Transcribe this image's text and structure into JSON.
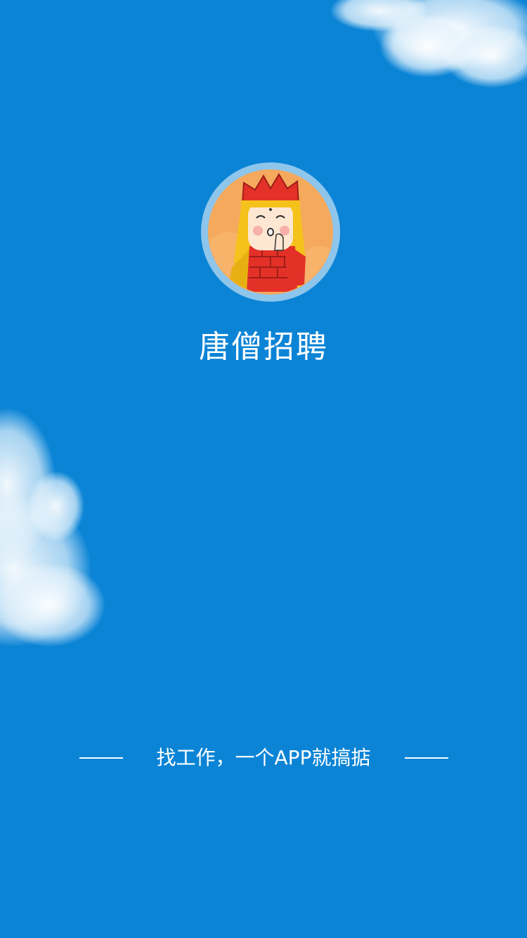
{
  "splash": {
    "app_name": "唐僧招聘",
    "slogan": "找工作，一个APP就搞掂"
  },
  "icons": {
    "logo": "tang-monk-avatar-logo",
    "cloud_top": "cloud-icon",
    "cloud_left": "cloud-icon"
  },
  "colors": {
    "background": "#0b84d6",
    "logo_ring": "#8ec5ea",
    "logo_fill": "#f5a95c",
    "text": "#ffffff"
  }
}
